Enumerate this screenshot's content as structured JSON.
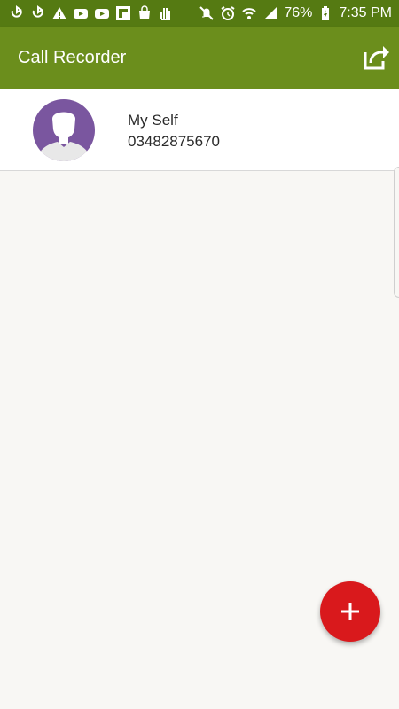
{
  "status_bar": {
    "left_icons": [
      "sync-icon",
      "sync-icon",
      "warning-icon",
      "youtube-icon",
      "youtube-icon",
      "flipboard-icon",
      "shopping-bag-icon",
      "hand-icon"
    ],
    "right_icons": [
      "mute-icon",
      "alarm-icon",
      "wifi-icon",
      "signal-icon",
      "battery-charging-icon"
    ],
    "battery": "76%",
    "time": "7:35 PM"
  },
  "app_bar": {
    "title": "Call Recorder",
    "share_icon": "share-icon"
  },
  "contacts": [
    {
      "name": "My Self",
      "number": "03482875670",
      "avatar_icon": "person-silhouette-icon"
    }
  ],
  "fab": {
    "icon": "plus-icon"
  },
  "colors": {
    "status_bar": "#557a12",
    "app_bar": "#6b8e1c",
    "avatar_bg": "#7a569f",
    "fab": "#d9191c",
    "background": "#f8f7f4"
  }
}
